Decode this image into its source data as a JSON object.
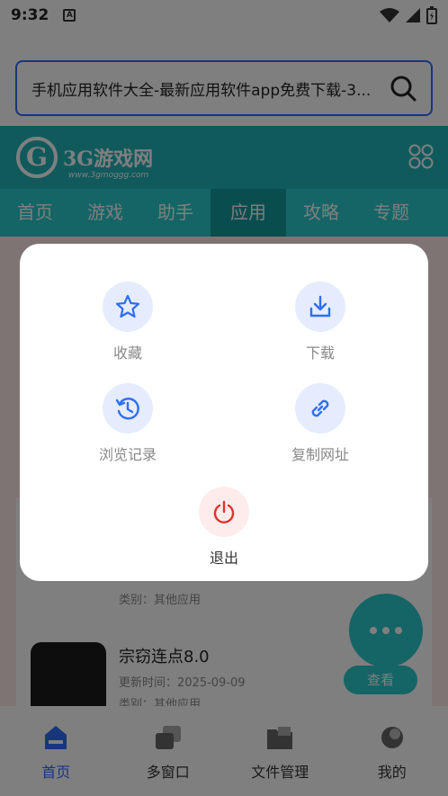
{
  "status_bar": {
    "time": "9:32",
    "a_badge": "A"
  },
  "search": {
    "text": "手机应用软件大全-最新应用软件app免费下载-3..."
  },
  "site": {
    "logo_g": "G",
    "logo_text": "3G游戏网",
    "logo_sub": "www.3gmoggg.com"
  },
  "nav": {
    "items": [
      "首页",
      "游戏",
      "助手",
      "应用",
      "攻略",
      "专题"
    ]
  },
  "background_list": {
    "item_top_category": "类别：其他应用",
    "item": {
      "title": "宗窃连点8.0",
      "time": "更新时间：2025-09-09",
      "category": "类别：其他应用",
      "button": "查看"
    }
  },
  "modal": {
    "items": [
      {
        "label": "收藏",
        "icon": "star-icon"
      },
      {
        "label": "下载",
        "icon": "download-icon"
      },
      {
        "label": "浏览记录",
        "icon": "history-icon"
      },
      {
        "label": "复制网址",
        "icon": "link-icon"
      },
      {
        "label": "退出",
        "icon": "power-icon"
      }
    ]
  },
  "tabbar": {
    "items": [
      {
        "label": "首页",
        "icon": "home-icon",
        "active": true
      },
      {
        "label": "多窗口",
        "icon": "windows-icon"
      },
      {
        "label": "文件管理",
        "icon": "folder-icon"
      },
      {
        "label": "我的",
        "icon": "profile-icon"
      }
    ]
  },
  "colors": {
    "accent": "#2f6df6",
    "teal": "#20b5b9",
    "exit_red": "#e0322f"
  }
}
